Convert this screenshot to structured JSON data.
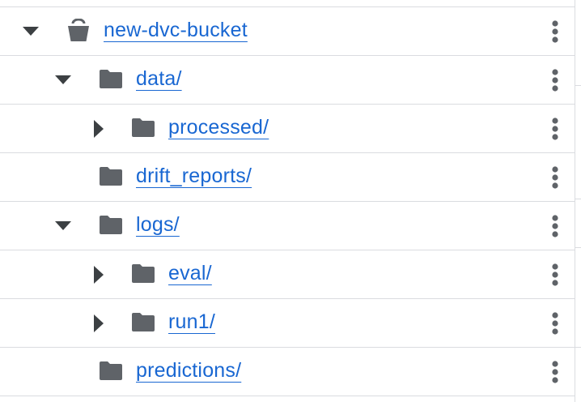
{
  "tree": {
    "rows": [
      {
        "name": "new-dvc-bucket",
        "kind": "bucket",
        "toggle": "expanded"
      },
      {
        "name": "data/",
        "kind": "folder",
        "toggle": "expanded"
      },
      {
        "name": "processed/",
        "kind": "folder",
        "toggle": "collapsed"
      },
      {
        "name": "drift_reports/",
        "kind": "folder",
        "toggle": "none"
      },
      {
        "name": "logs/",
        "kind": "folder",
        "toggle": "expanded"
      },
      {
        "name": "eval/",
        "kind": "folder",
        "toggle": "collapsed"
      },
      {
        "name": "run1/",
        "kind": "folder",
        "toggle": "collapsed"
      },
      {
        "name": "predictions/",
        "kind": "folder",
        "toggle": "none"
      }
    ]
  },
  "icons": {
    "expanded": "caret-down-icon",
    "collapsed": "caret-right-icon",
    "bucket": "bucket-icon",
    "folder": "folder-icon",
    "menu": "more-vert-icon"
  },
  "colors": {
    "link": "#1967d2",
    "icon": "#5f6368",
    "divider": "#dadce0"
  }
}
